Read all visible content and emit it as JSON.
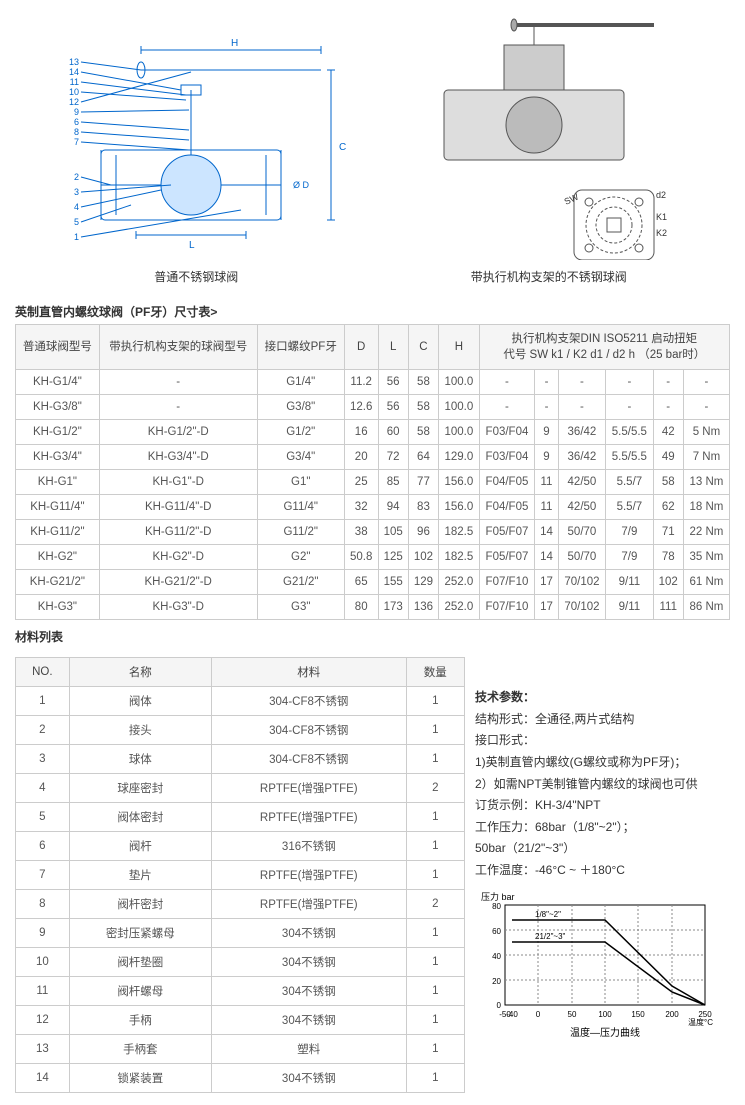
{
  "diagram_labels": {
    "left": "普通不锈钢球阀",
    "right": "带执行机构支架的不锈钢球阀"
  },
  "dim_table_title": "英制直管内螺纹球阀（PF牙）尺寸表>",
  "dim_headers": {
    "col1": "普通球阀型号",
    "col2": "带执行机构支架的球阀型号",
    "col3": "接口螺纹PF牙",
    "col4": "D",
    "col5": "L",
    "col6": "C",
    "col7": "H",
    "col8": "执行机构支架DIN ISO5211  启动扭矩\n代号 SW k1 / K2 d1 / d2 h （25 bar时）"
  },
  "dim_rows": [
    {
      "m": "KH-G1/4\"",
      "md": "-",
      "pf": "G1/4\"",
      "D": "11.2",
      "L": "56",
      "C": "58",
      "H": "100.0",
      "f": "-",
      "sw": "-",
      "k": "-",
      "d": "-",
      "h": "-",
      "t": "-"
    },
    {
      "m": "KH-G3/8\"",
      "md": "-",
      "pf": "G3/8\"",
      "D": "12.6",
      "L": "56",
      "C": "58",
      "H": "100.0",
      "f": "-",
      "sw": "-",
      "k": "-",
      "d": "-",
      "h": "-",
      "t": "-"
    },
    {
      "m": "KH-G1/2\"",
      "md": "KH-G1/2\"-D",
      "pf": "G1/2\"",
      "D": "16",
      "L": "60",
      "C": "58",
      "H": "100.0",
      "f": "F03/F04",
      "sw": "9",
      "k": "36/42",
      "d": "5.5/5.5",
      "h": "42",
      "t": "5 Nm"
    },
    {
      "m": "KH-G3/4\"",
      "md": "KH-G3/4\"-D",
      "pf": "G3/4\"",
      "D": "20",
      "L": "72",
      "C": "64",
      "H": "129.0",
      "f": "F03/F04",
      "sw": "9",
      "k": "36/42",
      "d": "5.5/5.5",
      "h": "49",
      "t": "7 Nm"
    },
    {
      "m": "KH-G1\"",
      "md": "KH-G1\"-D",
      "pf": "G1\"",
      "D": "25",
      "L": "85",
      "C": "77",
      "H": "156.0",
      "f": "F04/F05",
      "sw": "11",
      "k": "42/50",
      "d": "5.5/7",
      "h": "58",
      "t": "13 Nm"
    },
    {
      "m": "KH-G11/4\"",
      "md": "KH-G11/4\"-D",
      "pf": "G11/4\"",
      "D": "32",
      "L": "94",
      "C": "83",
      "H": "156.0",
      "f": "F04/F05",
      "sw": "11",
      "k": "42/50",
      "d": "5.5/7",
      "h": "62",
      "t": "18 Nm"
    },
    {
      "m": "KH-G11/2\"",
      "md": "KH-G11/2\"-D",
      "pf": "G11/2\"",
      "D": "38",
      "L": "105",
      "C": "96",
      "H": "182.5",
      "f": "F05/F07",
      "sw": "14",
      "k": "50/70",
      "d": "7/9",
      "h": "71",
      "t": "22 Nm"
    },
    {
      "m": "KH-G2\"",
      "md": "KH-G2\"-D",
      "pf": "G2\"",
      "D": "50.8",
      "L": "125",
      "C": "102",
      "H": "182.5",
      "f": "F05/F07",
      "sw": "14",
      "k": "50/70",
      "d": "7/9",
      "h": "78",
      "t": "35 Nm"
    },
    {
      "m": "KH-G21/2\"",
      "md": "KH-G21/2\"-D",
      "pf": "G21/2\"",
      "D": "65",
      "L": "155",
      "C": "129",
      "H": "252.0",
      "f": "F07/F10",
      "sw": "17",
      "k": "70/102",
      "d": "9/11",
      "h": "102",
      "t": "61 Nm"
    },
    {
      "m": "KH-G3\"",
      "md": "KH-G3\"-D",
      "pf": "G3\"",
      "D": "80",
      "L": "173",
      "C": "136",
      "H": "252.0",
      "f": "F07/F10",
      "sw": "17",
      "k": "70/102",
      "d": "9/11",
      "h": "111",
      "t": "86 Nm"
    }
  ],
  "mat_table_title": "材料列表",
  "mat_headers": {
    "no": "NO.",
    "name": "名称",
    "mat": "材料",
    "qty": "数量"
  },
  "mat_rows": [
    {
      "no": "1",
      "name": "阀体",
      "mat": "304-CF8不锈钢",
      "qty": "1"
    },
    {
      "no": "2",
      "name": "接头",
      "mat": "304-CF8不锈钢",
      "qty": "1"
    },
    {
      "no": "3",
      "name": "球体",
      "mat": "304-CF8不锈钢",
      "qty": "1"
    },
    {
      "no": "4",
      "name": "球座密封",
      "mat": "RPTFE(增强PTFE)",
      "qty": "2"
    },
    {
      "no": "5",
      "name": "阀体密封",
      "mat": "RPTFE(增强PTFE)",
      "qty": "1"
    },
    {
      "no": "6",
      "name": "阀杆",
      "mat": "316不锈钢",
      "qty": "1"
    },
    {
      "no": "7",
      "name": "垫片",
      "mat": "RPTFE(增强PTFE)",
      "qty": "1"
    },
    {
      "no": "8",
      "name": "阀杆密封",
      "mat": "RPTFE(增强PTFE)",
      "qty": "2"
    },
    {
      "no": "9",
      "name": "密封压紧螺母",
      "mat": "304不锈钢",
      "qty": "1"
    },
    {
      "no": "10",
      "name": "阀杆垫圈",
      "mat": "304不锈钢",
      "qty": "1"
    },
    {
      "no": "11",
      "name": "阀杆螺母",
      "mat": "304不锈钢",
      "qty": "1"
    },
    {
      "no": "12",
      "name": "手柄",
      "mat": "304不锈钢",
      "qty": "1"
    },
    {
      "no": "13",
      "name": "手柄套",
      "mat": "塑料",
      "qty": "1"
    },
    {
      "no": "14",
      "name": "锁紧装置",
      "mat": "304不锈钢",
      "qty": "1"
    }
  ],
  "tech_params_title": "技术参数：",
  "tech_lines": [
    "结构形式：全通径,两片式结构",
    "接口形式：",
    "1)英制直管内螺纹(G螺纹或称为PF牙)；",
    "2）如需NPT美制锥管内螺纹的球阀也可供",
    "订货示例：KH-3/4\"NPT",
    "工作压力：68bar（1/8\"~2\"）；",
    "50bar（21/2\"~3\"）",
    "工作温度：-46°C ~ ＋180°C"
  ],
  "chart_data": {
    "type": "line",
    "title": "温度—压力曲线",
    "xlabel": "温度°C",
    "ylabel": "压力 bar",
    "xlim": [
      -50,
      250
    ],
    "ylim": [
      0,
      80
    ],
    "x_ticks": [
      -50,
      -40,
      0,
      50,
      100,
      150,
      200,
      250
    ],
    "y_ticks": [
      0,
      20,
      40,
      60,
      80
    ],
    "series": [
      {
        "name": "1/8\"~2\"",
        "points": [
          [
            -40,
            68
          ],
          [
            100,
            68
          ],
          [
            200,
            15
          ],
          [
            250,
            0
          ]
        ]
      },
      {
        "name": "21/2\"~3\"",
        "points": [
          [
            -40,
            50
          ],
          [
            100,
            50
          ],
          [
            200,
            10
          ],
          [
            250,
            0
          ]
        ]
      }
    ]
  },
  "diagram_dims": {
    "H": "H",
    "C": "C",
    "L": "L",
    "D": "Ø D",
    "SW": "SW",
    "d2": "d2",
    "K1": "K1",
    "K2": "K2"
  },
  "diagram_callouts": [
    "1",
    "2",
    "3",
    "4",
    "5",
    "6",
    "7",
    "8",
    "9",
    "10",
    "11",
    "12",
    "13",
    "14"
  ]
}
